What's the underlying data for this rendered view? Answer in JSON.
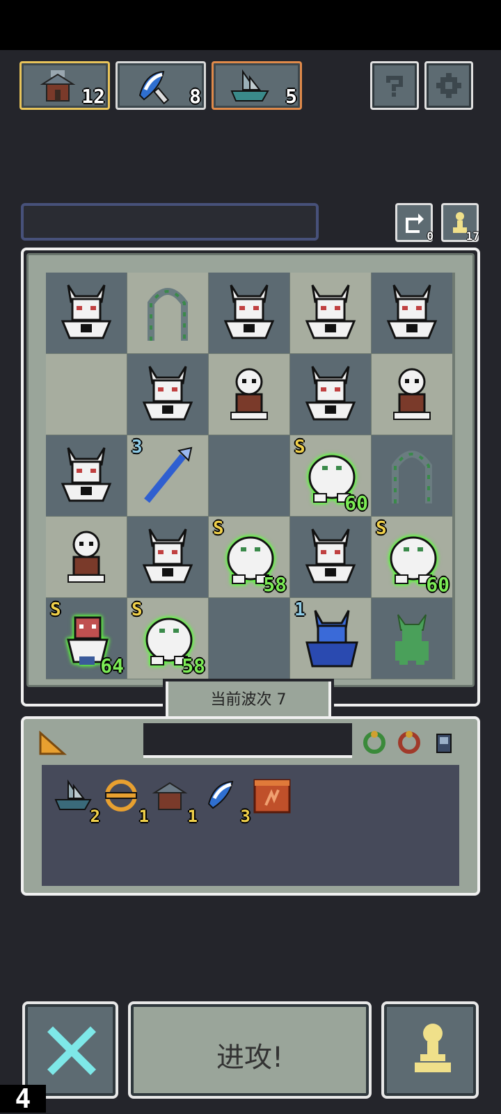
{
  "resources": [
    {
      "name": "workshop",
      "count": "12",
      "border": "#e8c45a"
    },
    {
      "name": "axe",
      "count": "8",
      "border": "#d8d8d8"
    },
    {
      "name": "ship",
      "count": "5",
      "border": "#e08a4a"
    }
  ],
  "header_buttons": {
    "help_icon": "question-icon",
    "settings_icon": "gear-icon"
  },
  "counters": {
    "reroll": "0",
    "pawn": "17"
  },
  "board": {
    "wave_label": "当前波次 7",
    "cells": [
      {
        "unit": "demon-warrior",
        "shade": "d"
      },
      {
        "unit": "vine-arch",
        "shade": "l"
      },
      {
        "unit": "demon-warrior",
        "shade": "d"
      },
      {
        "unit": "demon-warrior",
        "shade": "l"
      },
      {
        "unit": "demon-warrior",
        "shade": "d"
      },
      {
        "unit": "",
        "shade": "l"
      },
      {
        "unit": "demon-warrior",
        "shade": "d"
      },
      {
        "unit": "old-goblin",
        "shade": "l"
      },
      {
        "unit": "demon-warrior",
        "shade": "d"
      },
      {
        "unit": "old-goblin",
        "shade": "l"
      },
      {
        "unit": "demon-warrior",
        "shade": "d"
      },
      {
        "unit": "blue-spear",
        "shade": "l",
        "rank": "3",
        "rank_color": "blue"
      },
      {
        "unit": "",
        "shade": "d"
      },
      {
        "unit": "white-yeti",
        "shade": "l",
        "rank": "S",
        "hp": "60"
      },
      {
        "unit": "vine-arch",
        "shade": "d"
      },
      {
        "unit": "old-goblin",
        "shade": "l"
      },
      {
        "unit": "demon-warrior",
        "shade": "d"
      },
      {
        "unit": "white-yeti",
        "shade": "l",
        "rank": "S",
        "hp": "58"
      },
      {
        "unit": "demon-warrior",
        "shade": "d"
      },
      {
        "unit": "white-yeti",
        "shade": "l",
        "rank": "S",
        "hp": "60"
      },
      {
        "unit": "red-shaman",
        "shade": "d",
        "rank": "S",
        "hp": "64"
      },
      {
        "unit": "white-yeti",
        "shade": "l",
        "rank": "S",
        "hp": "58"
      },
      {
        "unit": "",
        "shade": "d"
      },
      {
        "unit": "blue-demon",
        "shade": "l",
        "rank": "1",
        "rank_color": "blue"
      },
      {
        "unit": "green-goblin",
        "shade": "d"
      }
    ]
  },
  "inventory": {
    "tab_icon": "cheese-icon",
    "filter_icons": [
      "green-ring-icon",
      "red-ring-icon",
      "armor-icon"
    ],
    "items": [
      {
        "name": "ship",
        "count": "2"
      },
      {
        "name": "shield-ring",
        "count": "1"
      },
      {
        "name": "workshop",
        "count": "1"
      },
      {
        "name": "axe",
        "count": "3"
      },
      {
        "name": "fire-scroll",
        "count": ""
      }
    ]
  },
  "bottom": {
    "attack_label": "进攻!",
    "level": "4"
  }
}
